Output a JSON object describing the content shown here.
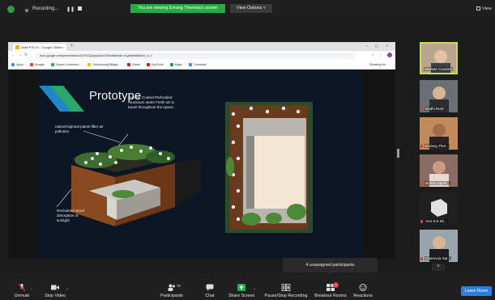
{
  "top_bar": {
    "recording_label": "Recording...",
    "viewing_banner": "You are viewing Enrang Theresia's screen",
    "view_options": "View Options",
    "view_label": "View"
  },
  "browser": {
    "tab_title": "Draft PITCH - Google Slides",
    "url": "docs.google.com/presentation/d/1FSGZjzqAu5UnDf2l/edit#slide=id.g9a6fd8a62cb_0_0",
    "bookmarks": [
      "Apps",
      "Google",
      "Depok Sobekmo...",
      "Gelombang Blitgar...",
      "Gmail",
      "YouTube",
      "Maps",
      "Translate"
    ],
    "reading_list": "Reading list"
  },
  "slide": {
    "title": "Prototype",
    "annotations": {
      "powder": "Powder Coated Perforated\nAluminum seats Fresh air to\ntravel throughout the space.",
      "native": "native/regional plants filter air\npollution",
      "reclaimed": "Reclaimed wood\nabsorption of\nsunlight"
    }
  },
  "participants_panel": {
    "tiles": [
      {
        "name": "Matisse Cousins"
      },
      {
        "name": "Bodhi Reid"
      },
      {
        "name": "Enrang Ther..."
      },
      {
        "name": "simran agnih..."
      },
      {
        "name": "Ami S.E.Mi..."
      },
      {
        "name": "Clarencia Sat..."
      }
    ]
  },
  "popover": {
    "text": "4 unassigned participants"
  },
  "toolbar": {
    "unmute": "Unmute",
    "stop_video": "Stop Video",
    "participants": "Participants",
    "participants_count": "75",
    "chat": "Chat",
    "share_screen": "Share Screen",
    "pause_recording": "Pause/Stop Recording",
    "breakout_rooms": "Breakout Rooms",
    "breakout_badge": "4",
    "reactions": "Reactions",
    "leave": "Leave Room"
  },
  "colors": {
    "green_banner": "#27ab3e",
    "leave_blue": "#2f7de1",
    "active_speaker": "#c8df52",
    "slide_bg": "#0d1624"
  }
}
